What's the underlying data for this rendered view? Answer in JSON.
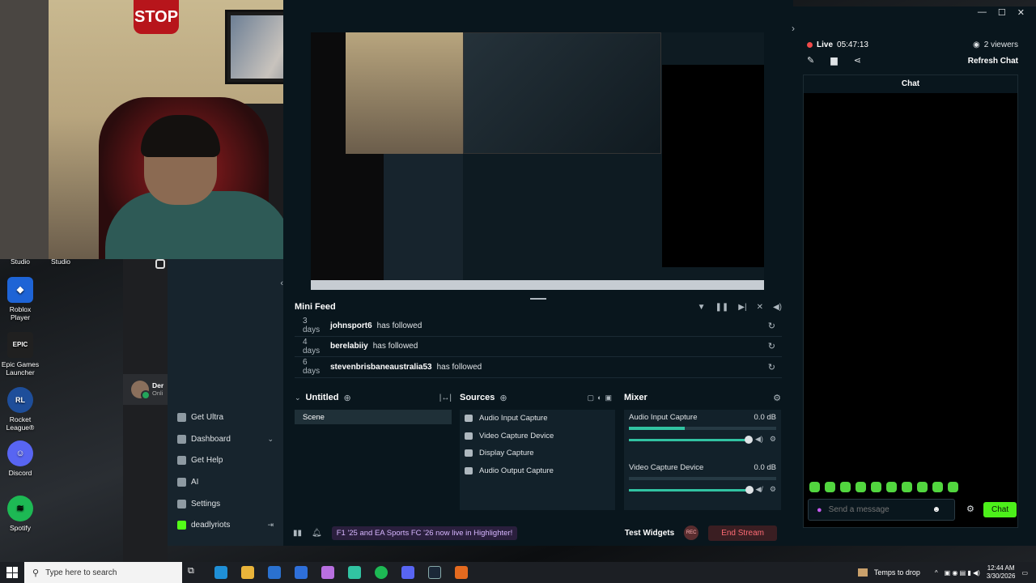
{
  "desktop": {
    "icons": [
      {
        "label": "Studio",
        "color": "#3a3a3a",
        "glyph": ""
      },
      {
        "label": "Studio",
        "color": "#3a3a3a",
        "glyph": ""
      },
      {
        "label": "Roblox Player",
        "color": "#1e64d6",
        "glyph": "◆"
      },
      {
        "label": "Epic Games Launcher",
        "color": "#202020",
        "glyph": "EPIC"
      },
      {
        "label": "Rocket League®",
        "color": "#1e4e9a",
        "glyph": "RL"
      },
      {
        "label": "Discord",
        "color": "#5865f2",
        "glyph": "☺"
      },
      {
        "label": "Spotify",
        "color": "#1db954",
        "glyph": "≋"
      }
    ]
  },
  "webcam": {
    "sign_text": "STOP"
  },
  "discord": {
    "user_short": "Der",
    "status_short": "Onli"
  },
  "streamlabs": {
    "nav": [
      {
        "label": "Get Ultra",
        "icon": "ultra-icon"
      },
      {
        "label": "Dashboard",
        "icon": "dashboard-icon",
        "chevron": "⌄"
      },
      {
        "label": "Get Help",
        "icon": "help-icon"
      },
      {
        "label": "AI",
        "icon": "ai-icon"
      },
      {
        "label": "Settings",
        "icon": "gear-icon"
      },
      {
        "label": "deadlyriots",
        "icon": "kick-icon"
      }
    ],
    "mini_feed": {
      "title": "Mini Feed",
      "rows": [
        {
          "ago": "3 days",
          "user": "johnsport6",
          "action": "has followed"
        },
        {
          "ago": "4 days",
          "user": "berelabiiy",
          "action": "has followed"
        },
        {
          "ago": "6 days",
          "user": "stevenbrisbaneaustralia53",
          "action": "has followed"
        }
      ]
    },
    "scenes": {
      "title": "Untitled",
      "items": [
        "Scene"
      ]
    },
    "sources": {
      "title": "Sources",
      "items": [
        "Audio Input Capture",
        "Video Capture Device",
        "Display Capture",
        "Audio Output Capture"
      ]
    },
    "mixer": {
      "title": "Mixer",
      "channels": [
        {
          "name": "Audio Input Capture",
          "db": "0.0 dB",
          "level": 0.38
        },
        {
          "name": "Video Capture Device",
          "db": "0.0 dB",
          "level": 0.0
        }
      ]
    },
    "footer": {
      "highlight": "F1 '25 and EA Sports FC '26 now live in Highlighter!",
      "test_widgets": "Test Widgets",
      "rec": "REC",
      "end_stream": "End Stream"
    }
  },
  "chat": {
    "live_label": "Live",
    "live_time": "05:47:13",
    "viewers": "2 viewers",
    "refresh": "Refresh Chat",
    "title": "Chat",
    "placeholder": "Send a message",
    "send": "Chat",
    "emote_count": 10
  },
  "taskbar": {
    "search_placeholder": "Type here to search",
    "weather": "Temps to drop",
    "time": "12:44 AM",
    "date": "3/30/2026"
  },
  "colors": {
    "accent": "#31c3a2",
    "live": "#f04a4a",
    "send": "#4cf01a",
    "end": "#ff6b74"
  }
}
